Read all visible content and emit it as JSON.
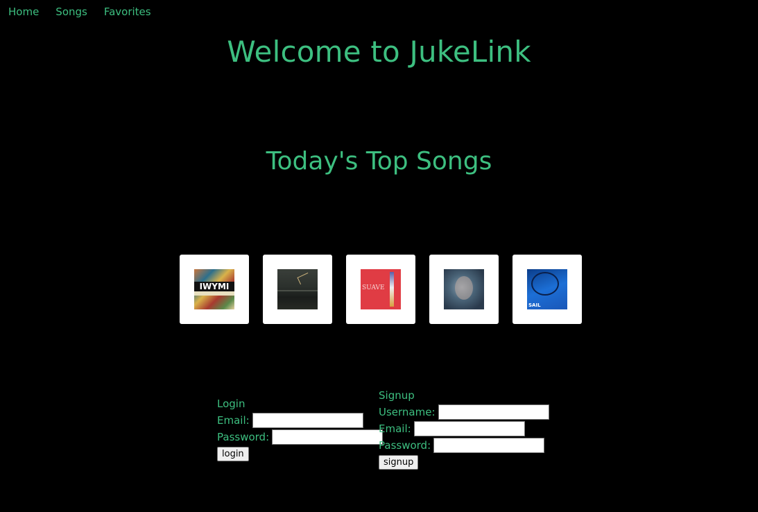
{
  "nav": {
    "items": [
      {
        "label": "Home"
      },
      {
        "label": "Songs"
      },
      {
        "label": "Favorites"
      }
    ]
  },
  "main": {
    "title": "Welcome to JukeLink",
    "top_songs_heading": "Today's Top Songs",
    "songs": [
      {
        "cover": "collage-album-cover",
        "cover_text": "IWYMI"
      },
      {
        "cover": "dark-landscape-album-cover"
      },
      {
        "cover": "red-album-cover",
        "cover_text": "SUAVE"
      },
      {
        "cover": "blurred-portrait-album-cover"
      },
      {
        "cover": "blue-album-cover",
        "cover_text": "SAIL"
      }
    ]
  },
  "login": {
    "heading": "Login",
    "email_label": "Email:",
    "email_value": "",
    "password_label": "Password:",
    "password_value": "",
    "button_label": "login"
  },
  "signup": {
    "heading": "Signup",
    "username_label": "Username:",
    "username_value": "",
    "email_label": "Email:",
    "email_value": "",
    "password_label": "Password:",
    "password_value": "",
    "button_label": "signup"
  },
  "colors": {
    "background": "#000000",
    "accent": "#3dbf80",
    "card": "#ffffff"
  }
}
